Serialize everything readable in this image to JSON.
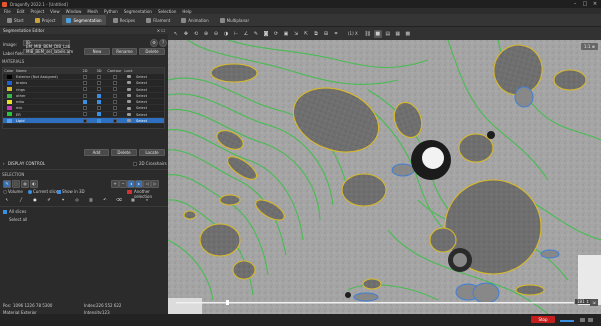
{
  "window": {
    "title": "Dragonfly 2022.1 - [Untitled]",
    "logo_color": "#e8542c"
  },
  "menu": [
    "File",
    "Edit",
    "Project",
    "View",
    "Window",
    "Mesh",
    "Python",
    "Segmentation",
    "Selection",
    "Help"
  ],
  "tabs": [
    {
      "label": "Start",
      "icon": "home-icon",
      "active": false
    },
    {
      "label": "Project",
      "icon": "folder-icon",
      "active": false
    },
    {
      "label": "Segmentation",
      "icon": "segmentation-icon",
      "active": true
    },
    {
      "label": "Recipes",
      "icon": "recipes-icon",
      "active": false
    },
    {
      "label": "Filament",
      "icon": "filament-icon",
      "active": false
    },
    {
      "label": "Animation",
      "icon": "animation-icon",
      "active": false
    },
    {
      "label": "Multiplanar",
      "icon": "multiplanar-icon",
      "active": false
    }
  ],
  "panel": {
    "title": "Segmentation Editor",
    "image_label": "Image:",
    "image_value": "IB-EM_MIB_BEM_DIB_Lab (",
    "label_field_label": "Label field:",
    "label_field_value": "MIB_BEM_sel_labels.am",
    "new_button": "New",
    "rename_button": "Rename",
    "delete_button": "Delete",
    "materials_title": "MATERIALS",
    "columns": [
      "Color",
      "Name",
      "2D",
      "3D",
      "Contour",
      "Lock",
      ""
    ],
    "materials": [
      {
        "name": "Exterior (Not Assigned)",
        "color": "#000000",
        "d2": false,
        "d3": false,
        "lock": false,
        "select": "Select",
        "selected": false
      },
      {
        "name": "brains",
        "color": "#1e5fd4",
        "d2": false,
        "d3": false,
        "lock": false,
        "select": "Select",
        "selected": false
      },
      {
        "name": "rings",
        "color": "#d8b92a",
        "d2": false,
        "d3": false,
        "lock": false,
        "select": "Select",
        "selected": false
      },
      {
        "name": "other",
        "color": "#35b84a",
        "d2": false,
        "d3": true,
        "lock": false,
        "select": "Select",
        "selected": false
      },
      {
        "name": "mito",
        "color": "#e8e023",
        "d2": true,
        "d3": true,
        "lock": false,
        "select": "Select",
        "selected": false
      },
      {
        "name": "mic",
        "color": "#c43ab8",
        "d2": false,
        "d3": false,
        "lock": false,
        "select": "Select",
        "selected": false
      },
      {
        "name": "ER",
        "color": "#25c43a",
        "d2": false,
        "d3": true,
        "lock": false,
        "select": "Select",
        "selected": false
      },
      {
        "name": "Lipid",
        "color": "#5aa0e8",
        "d2": false,
        "d3": true,
        "lock": false,
        "select": "Select",
        "selected": true
      }
    ],
    "add_button": "Add",
    "delete_material_button": "Delete",
    "locate_button": "Locate",
    "crosshairs_label": "2D Crosshairs",
    "display_control": "DISPLAY CONTROL",
    "selection_title": "SELECTION",
    "volume_label": "Volume",
    "current_slice_label": "Current slice",
    "show_3d_label": "Show in 3D",
    "another_selection_label": "Another selection",
    "all_slices_label": "All slices",
    "select_all": "Select all"
  },
  "status": {
    "pos_label": "Pos:",
    "pos_value": "1096 1226 78 5300",
    "index_label": "Index:",
    "index_value": "226 552 622",
    "material_label": "Material:",
    "material_value": "Exterior",
    "intensity_label": "Intensity:",
    "intensity_value": "123"
  },
  "viewport": {
    "zoom": "(1) X",
    "slice_label": "181 ↕"
  },
  "stop_button": "Stop"
}
